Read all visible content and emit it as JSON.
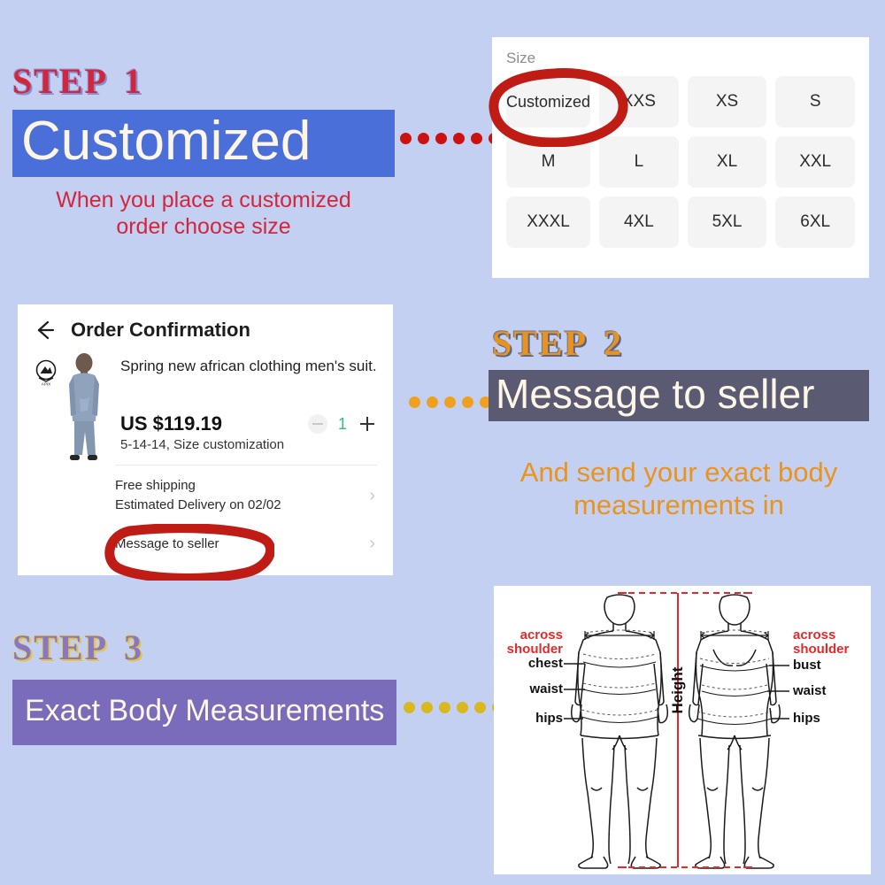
{
  "background_color": "#c3d0f2",
  "steps": [
    {
      "id": "step-1",
      "heading_word": "STEP",
      "heading_number": "1",
      "banner_text": "Customized",
      "banner_color": "#4a6fd8",
      "caption": "When you place a customized\norder choose size",
      "caption_color": "#d3253b",
      "dot_color": "#cc1111"
    },
    {
      "id": "step-2",
      "heading_word": "STEP",
      "heading_number": "2",
      "banner_text": "Message to seller",
      "banner_color": "#5a5a72",
      "caption": "And send your exact body\nmeasurements in",
      "caption_color": "#e8941f",
      "dot_color": "#f0a020"
    },
    {
      "id": "step-3",
      "heading_word": "STEP",
      "heading_number": "3",
      "banner_text": "Exact Body Measurements",
      "banner_color": "#7a6cba",
      "dot_color": "#d9b81e"
    }
  ],
  "size_panel": {
    "label": "Size",
    "options": [
      "Customized",
      "XXS",
      "XS",
      "S",
      "M",
      "L",
      "XL",
      "XXL",
      "XXXL",
      "4XL",
      "5XL",
      "6XL"
    ],
    "highlighted_option": "Customized",
    "highlight_color": "#c01c16"
  },
  "order_card": {
    "back_icon": "back-arrow-icon",
    "title": "Order Confirmation",
    "brand_logo": "apix-brand-logo",
    "product_image": "product-thumbnail-mens-suit",
    "product_name": "Spring new african clothing men's suit...",
    "price": "US $119.19",
    "variant": "5-14-14,  Size customization",
    "quantity": "1",
    "minus_label": "−",
    "plus_label": "+",
    "shipping_line1": "Free shipping",
    "shipping_line2": "Estimated Delivery on 02/02",
    "message_row": "Message to seller",
    "highlighted_row": "Message to seller",
    "highlight_color": "#c01c16"
  },
  "measurement_chart": {
    "height_label": "Height",
    "left_labels": [
      "across\nshoulder",
      "chest",
      "waist",
      "hips"
    ],
    "right_labels": [
      "across\nshoulder",
      "bust",
      "waist",
      "hips"
    ],
    "accent_color": "#e02b2b"
  }
}
